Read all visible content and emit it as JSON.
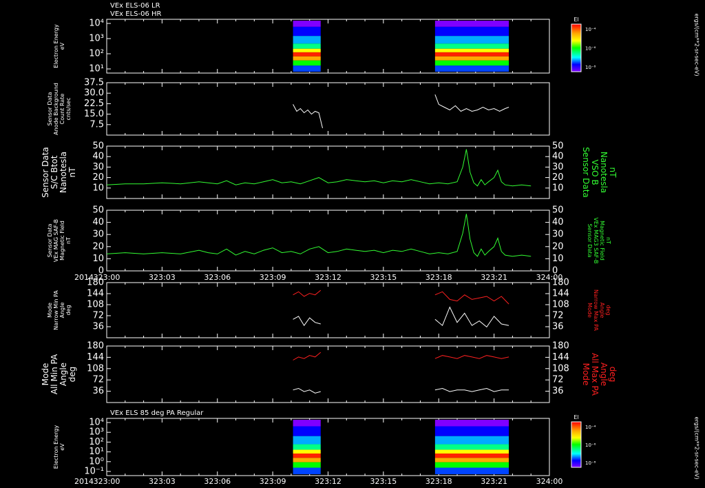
{
  "header": {
    "line1": "VEx ELS-06 LR",
    "line2": "VEx ELS-06 HR"
  },
  "time_axis": {
    "year": "2014",
    "ticks": [
      "323:00",
      "323:03",
      "323:06",
      "323:09",
      "323:12",
      "323:15",
      "323:18",
      "323:21",
      "324:00"
    ]
  },
  "colorbar": {
    "title": "El",
    "ticks": [
      "10⁻⁴",
      "10⁻⁶",
      "10⁻⁸"
    ],
    "units": "ergs/(cm**2-sr-sec-eV)"
  },
  "footer_title": "VEx ELS 85 deg PA Regular",
  "colors": {
    "background": "#000000",
    "axis": "#ffffff",
    "green": "#33ff33",
    "red": "#ff2020"
  },
  "chart_data": [
    {
      "type": "heatmap",
      "title": "VEx ELS-06 LR / VEx ELS-06 HR",
      "ylabel": [
        "Electron Energy",
        "eV"
      ],
      "yticks": [
        "10⁴",
        "10³",
        "10²",
        "10¹"
      ],
      "data_intervals": [
        [
          "323:10",
          "323:11"
        ],
        [
          "323:18",
          "323:21"
        ]
      ]
    },
    {
      "type": "line",
      "ylabel": [
        "Sensor Data",
        "Anode Background",
        "Count Rate",
        "cnts/sec"
      ],
      "ylim": [
        0,
        37.5
      ],
      "yticks": [
        "37.5",
        "30.0",
        "22.5",
        "15.0",
        "7.5"
      ],
      "series": [
        {
          "color": "#ffffff",
          "x": [
            10.1,
            10.3,
            10.5,
            10.7,
            10.9,
            11.1,
            11.3,
            11.5,
            11.7
          ],
          "y": [
            22,
            17,
            19,
            16,
            18,
            15,
            17,
            16,
            5
          ]
        },
        {
          "color": "#ffffff",
          "x": [
            17.8,
            18.0,
            18.3,
            18.6,
            18.9,
            19.2,
            19.5,
            19.8,
            20.1,
            20.4,
            20.7,
            21.0,
            21.3,
            21.6,
            21.8
          ],
          "y": [
            29,
            22,
            20,
            18,
            21,
            17,
            19,
            17,
            18,
            20,
            18,
            19,
            17,
            19,
            20
          ]
        }
      ]
    },
    {
      "type": "line",
      "ylabel": [
        "Sensor Data",
        "S/C Btot",
        "Nanotesla",
        "nT"
      ],
      "right_label": [
        "Sensor Data",
        "VSO B",
        "Nanotesla",
        "nT"
      ],
      "ylim": [
        0,
        50
      ],
      "yticks": [
        "50",
        "40",
        "30",
        "20",
        "10"
      ],
      "series": [
        {
          "color": "#33ff33",
          "x": [
            0,
            1,
            2,
            3,
            4,
            5,
            5.5,
            6,
            6.5,
            7,
            7.5,
            8,
            8.5,
            9,
            9.5,
            10,
            10.5,
            11,
            11.5,
            12,
            12.5,
            13,
            13.5,
            14,
            14.5,
            15,
            15.5,
            16,
            16.5,
            17,
            17.5,
            18,
            18.5,
            19,
            19.3,
            19.5,
            19.7,
            19.9,
            20.1,
            20.3,
            20.5,
            20.7,
            21,
            21.2,
            21.4,
            21.6,
            22,
            22.5,
            23
          ],
          "y": [
            13,
            14,
            14,
            15,
            14,
            16,
            15,
            14,
            17,
            13,
            15,
            14,
            16,
            18,
            15,
            16,
            14,
            17,
            20,
            15,
            16,
            18,
            17,
            16,
            17,
            15,
            17,
            16,
            18,
            16,
            14,
            15,
            14,
            16,
            30,
            47,
            25,
            15,
            12,
            18,
            13,
            16,
            20,
            27,
            16,
            13,
            12,
            13,
            12
          ]
        }
      ]
    },
    {
      "type": "line",
      "ylabel": [
        "Sensor Data",
        "VEx MAG SAF-B",
        "Magnetic Field",
        "nT"
      ],
      "right_label": [
        "Sensor Data",
        "VEx MAG3 SAF-B",
        "Magnetic Field",
        "nT"
      ],
      "ylim": [
        0,
        50
      ],
      "yticks": [
        "50",
        "40",
        "30",
        "20",
        "10",
        "0"
      ],
      "series": [
        {
          "color": "#33ff33",
          "x": [
            0,
            1,
            2,
            3,
            4,
            5,
            5.5,
            6,
            6.5,
            7,
            7.5,
            8,
            8.5,
            9,
            9.5,
            10,
            10.5,
            11,
            11.5,
            12,
            12.5,
            13,
            13.5,
            14,
            14.5,
            15,
            15.5,
            16,
            16.5,
            17,
            17.5,
            18,
            18.5,
            19,
            19.3,
            19.5,
            19.7,
            19.9,
            20.1,
            20.3,
            20.5,
            20.7,
            21,
            21.2,
            21.4,
            21.6,
            22,
            22.5,
            23
          ],
          "y": [
            14,
            15,
            14,
            15,
            14,
            17,
            15,
            14,
            18,
            13,
            16,
            14,
            17,
            19,
            15,
            16,
            14,
            18,
            20,
            15,
            16,
            18,
            17,
            16,
            17,
            15,
            17,
            16,
            18,
            16,
            14,
            15,
            14,
            16,
            31,
            47,
            26,
            15,
            12,
            18,
            13,
            16,
            20,
            27,
            16,
            13,
            12,
            13,
            12
          ]
        }
      ]
    },
    {
      "type": "line",
      "ylabel": [
        "Mode",
        "Narrow Min PA",
        "Angle",
        "deg"
      ],
      "right_label": [
        "Mode",
        "Narrow Max PA",
        "Angle",
        "deg"
      ],
      "ylim": [
        0,
        180
      ],
      "yticks": [
        "180",
        "144",
        "108",
        "72",
        "36"
      ],
      "series": [
        {
          "color": "#ff2020",
          "x": [
            10.1,
            10.4,
            10.7,
            11.0,
            11.3,
            11.6
          ],
          "y": [
            140,
            150,
            135,
            145,
            140,
            155
          ]
        },
        {
          "color": "#ffffff",
          "x": [
            10.1,
            10.4,
            10.7,
            11.0,
            11.3,
            11.6
          ],
          "y": [
            60,
            70,
            40,
            65,
            50,
            45
          ]
        },
        {
          "color": "#ff2020",
          "x": [
            17.8,
            18.2,
            18.6,
            19.0,
            19.4,
            19.8,
            20.2,
            20.6,
            21.0,
            21.4,
            21.8
          ],
          "y": [
            140,
            150,
            125,
            120,
            140,
            125,
            130,
            135,
            120,
            135,
            110
          ]
        },
        {
          "color": "#ffffff",
          "x": [
            17.8,
            18.2,
            18.6,
            19.0,
            19.4,
            19.8,
            20.2,
            20.6,
            21.0,
            21.4,
            21.8
          ],
          "y": [
            60,
            40,
            100,
            50,
            80,
            40,
            55,
            35,
            70,
            45,
            40
          ]
        }
      ]
    },
    {
      "type": "line",
      "ylabel": [
        "Mode",
        "All Min PA",
        "Angle",
        "deg"
      ],
      "right_label": [
        "Mode",
        "All Max PA",
        "Angle",
        "deg"
      ],
      "ylim": [
        0,
        180
      ],
      "yticks": [
        "180",
        "144",
        "108",
        "72",
        "36"
      ],
      "series": [
        {
          "color": "#ff2020",
          "x": [
            10.1,
            10.4,
            10.7,
            11.0,
            11.3,
            11.6
          ],
          "y": [
            135,
            145,
            140,
            150,
            145,
            160
          ]
        },
        {
          "color": "#ffffff",
          "x": [
            10.1,
            10.4,
            10.7,
            11.0,
            11.3,
            11.6
          ],
          "y": [
            40,
            45,
            35,
            40,
            30,
            35
          ]
        },
        {
          "color": "#ff2020",
          "x": [
            17.8,
            18.2,
            18.6,
            19.0,
            19.4,
            19.8,
            20.2,
            20.6,
            21.0,
            21.4,
            21.8
          ],
          "y": [
            140,
            150,
            145,
            140,
            150,
            145,
            140,
            150,
            145,
            140,
            145
          ]
        },
        {
          "color": "#ffffff",
          "x": [
            17.8,
            18.2,
            18.6,
            19.0,
            19.4,
            19.8,
            20.2,
            20.6,
            21.0,
            21.4,
            21.8
          ],
          "y": [
            40,
            45,
            35,
            40,
            40,
            35,
            40,
            45,
            35,
            40,
            40
          ]
        }
      ]
    },
    {
      "type": "heatmap",
      "title": "VEx ELS 85 deg PA Regular",
      "ylabel": [
        "Electron Energy",
        "eV"
      ],
      "yticks": [
        "10⁴",
        "10³",
        "10²",
        "10¹",
        "10⁰",
        "10⁻¹"
      ],
      "data_intervals": [
        [
          "323:10",
          "323:11"
        ],
        [
          "323:18",
          "323:21"
        ]
      ]
    }
  ]
}
